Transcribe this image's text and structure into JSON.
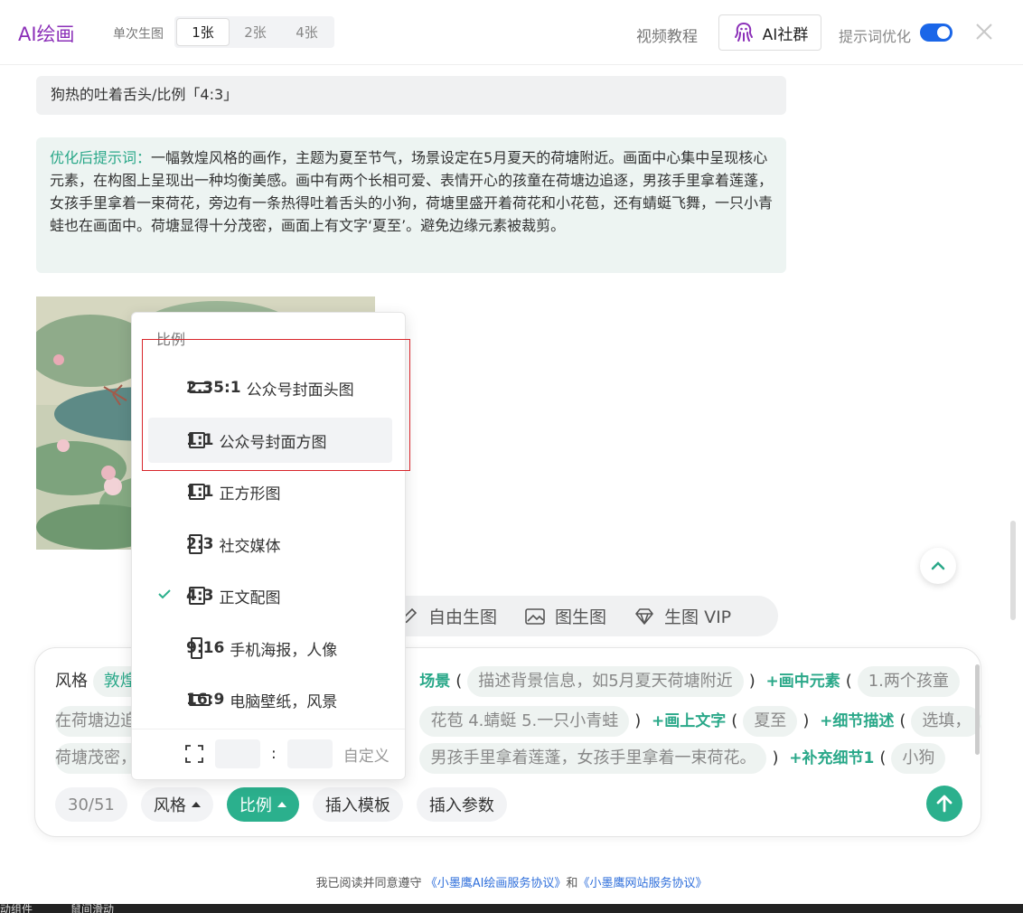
{
  "header": {
    "app_title": "AI绘画",
    "count_label": "单次生图",
    "count_options": [
      "1张",
      "2张",
      "4张"
    ],
    "selected_count": "1张",
    "video_tutorial": "视频教程",
    "community_button": "AI社群",
    "prompt_optimize_label": "提示词优化",
    "prompt_optimize_on": true
  },
  "chat": {
    "user_message_tail": "狗热的吐着舌头/比例「4:3」",
    "optimized_prefix": "优化后提示词：",
    "optimized_text": "一幅敦煌风格的画作，主题为夏至节气，场景设定在5月夏天的荷塘附近。画面中心集中呈现核心元素，在构图上呈现出一种均衡美感。画中有两个长相可爱、表情开心的孩童在荷塘边追逐，男孩手里拿着莲蓬，女孩手里拿着一束荷花，旁边有一条热得吐着舌头的小狗，荷塘里盛开着荷花和小花苞，还有蜻蜓飞舞，一只小青蛙也在画面中。荷塘显得十分茂密，画面上有文字‘夏至’。避免边缘元素被裁剪。"
  },
  "modes": [
    {
      "label": "自由生图",
      "icon": "pen-icon"
    },
    {
      "label": "图生图",
      "icon": "image-icon"
    },
    {
      "label": "生图 VIP",
      "icon": "diamond-icon"
    }
  ],
  "prompt": {
    "line1": {
      "style_label": "风格",
      "style_chip": "敦煌",
      "scene_kw": "场景",
      "scene_chip": "描述背景信息，如5月夏天荷塘附近",
      "elements_kw": "+画中元素",
      "elements_chip": "1.两个孩童"
    },
    "line2": {
      "start_chip": "在荷塘边追",
      "middle_chip": "花苞 4.蜻蜓 5.一只小青蛙",
      "text_kw": "+画上文字",
      "text_chip": "夏至",
      "detail_kw": "+细节描述",
      "detail_chip": "选填，"
    },
    "line3": {
      "start_chip": "荷塘茂密，",
      "middle_chip": "男孩手里拿着莲蓬，女孩手里拿着一束荷花。",
      "extra_kw": "+补充细节1",
      "extra_chip": "小狗"
    }
  },
  "bottom_bar": {
    "char_count": "30/51",
    "style_btn": "风格",
    "ratio_btn": "比例",
    "insert_template": "插入模板",
    "insert_param": "插入参数"
  },
  "ratio_dropdown": {
    "header": "比例",
    "items": [
      {
        "ratio": "2.35:1",
        "label": "公众号封面头图",
        "shape": "wide",
        "selected": false
      },
      {
        "ratio": "1:1",
        "label": "公众号封面方图",
        "shape": "square",
        "selected": false
      },
      {
        "ratio": "1:1",
        "label": "正方形图",
        "shape": "square",
        "selected": false
      },
      {
        "ratio": "2:3",
        "label": "社交媒体",
        "shape": "portrait",
        "selected": false
      },
      {
        "ratio": "4:3",
        "label": "正文配图",
        "shape": "square",
        "selected": true
      },
      {
        "ratio": "9:16",
        "label": "手机海报，人像",
        "shape": "tall",
        "selected": false
      },
      {
        "ratio": "16:9",
        "label": "电脑壁纸，风景",
        "shape": "wide",
        "selected": false
      }
    ],
    "custom_colon": ":",
    "custom_label": "自定义"
  },
  "footer": {
    "prefix": "我已阅读并同意遵守",
    "link1": "《小墨鹰AI绘画服务协议》",
    "and": "和",
    "link2": "《小墨鹰网站服务协议》"
  },
  "bottom_strip": {
    "left_text": "动组件",
    "right_text": "鼠间滑动"
  },
  "colors": {
    "brand_purple": "#8b2fb8",
    "accent_green": "#2bb08d",
    "toggle_blue": "#1a66e8",
    "link_blue": "#2f6fdb",
    "highlight_red": "#d8252a"
  }
}
